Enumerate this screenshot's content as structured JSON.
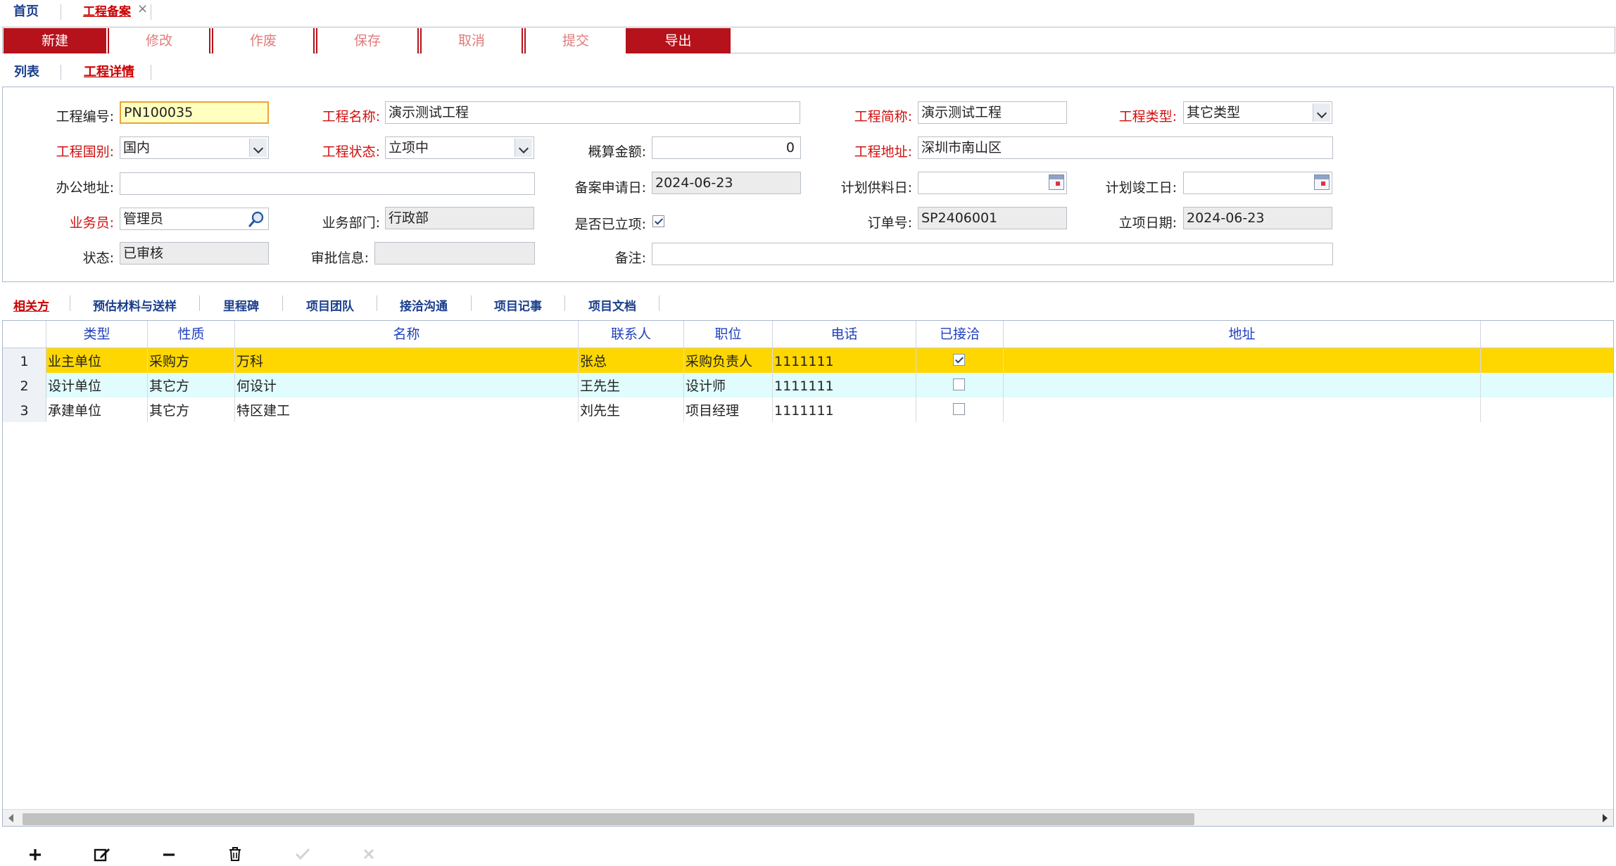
{
  "top_tabs": [
    {
      "label": "首页",
      "active": false
    },
    {
      "label": "工程备案",
      "active": true
    }
  ],
  "tab_close": "×",
  "toolbar": {
    "buttons": [
      {
        "label": "新建",
        "enabled": true
      },
      {
        "label": "修改",
        "enabled": false
      },
      {
        "label": "作废",
        "enabled": false
      },
      {
        "label": "保存",
        "enabled": false
      },
      {
        "label": "取消",
        "enabled": false
      },
      {
        "label": "提交",
        "enabled": false
      },
      {
        "label": "导出",
        "enabled": true
      }
    ]
  },
  "view_tabs": [
    {
      "label": "列表",
      "active": false
    },
    {
      "label": "工程详情",
      "active": true
    }
  ],
  "form": {
    "project_no": {
      "label": "工程编号:",
      "value": "PN100035"
    },
    "project_name": {
      "label": "工程名称:",
      "value": "演示测试工程"
    },
    "short_name": {
      "label": "工程简称:",
      "value": "演示测试工程"
    },
    "project_type": {
      "label": "工程类型:",
      "value": "其它类型"
    },
    "country": {
      "label": "工程国别:",
      "value": "国内"
    },
    "project_status": {
      "label": "工程状态:",
      "value": "立项中"
    },
    "estimate": {
      "label": "概算金额:",
      "value": "0"
    },
    "project_address": {
      "label": "工程地址:",
      "value": "深圳市南山区"
    },
    "office_address": {
      "label": "办公地址:",
      "value": ""
    },
    "apply_date": {
      "label": "备案申请日:",
      "value": "2024-06-23"
    },
    "plan_supply_date": {
      "label": "计划供料日:",
      "value": ""
    },
    "plan_finish_date": {
      "label": "计划竣工日:",
      "value": ""
    },
    "salesman": {
      "label": "业务员:",
      "value": "管理员"
    },
    "department": {
      "label": "业务部门:",
      "value": "行政部"
    },
    "approved": {
      "label": "是否已立项:",
      "checked": true
    },
    "order_no": {
      "label": "订单号:",
      "value": "SP2406001"
    },
    "setup_date": {
      "label": "立项日期:",
      "value": "2024-06-23"
    },
    "status": {
      "label": "状态:",
      "value": "已审核"
    },
    "approval_info": {
      "label": "审批信息:",
      "value": ""
    },
    "remark": {
      "label": "备注:",
      "value": ""
    }
  },
  "detail_tabs": [
    {
      "label": "相关方",
      "active": true
    },
    {
      "label": "预估材料与送样",
      "active": false
    },
    {
      "label": "里程碑",
      "active": false
    },
    {
      "label": "项目团队",
      "active": false
    },
    {
      "label": "接洽沟通",
      "active": false
    },
    {
      "label": "项目记事",
      "active": false
    },
    {
      "label": "项目文档",
      "active": false
    }
  ],
  "grid": {
    "columns": [
      "类型",
      "性质",
      "名称",
      "联系人",
      "职位",
      "电话",
      "已接洽",
      "地址"
    ],
    "rows": [
      {
        "no": "1",
        "type": "业主单位",
        "nature": "采购方",
        "name": "万科",
        "contact": "张总",
        "position": "采购负责人",
        "phone": "1111111",
        "contacted": true,
        "address": ""
      },
      {
        "no": "2",
        "type": "设计单位",
        "nature": "其它方",
        "name": "何设计",
        "contact": "王先生",
        "position": "设计师",
        "phone": "1111111",
        "contacted": false,
        "address": ""
      },
      {
        "no": "3",
        "type": "承建单位",
        "nature": "其它方",
        "name": "特区建工",
        "contact": "刘先生",
        "position": "项目经理",
        "phone": "1111111",
        "contacted": false,
        "address": ""
      }
    ],
    "row_colors": {
      "selected": "#ffd700",
      "hover": "#e0fcfc",
      "normal": "#ffffff"
    }
  },
  "grid_actions": [
    {
      "icon": "plus-icon",
      "enabled": true
    },
    {
      "icon": "edit-icon",
      "enabled": true
    },
    {
      "icon": "minus-icon",
      "enabled": true
    },
    {
      "icon": "trash-icon",
      "enabled": true
    },
    {
      "icon": "check-icon",
      "enabled": false
    },
    {
      "icon": "close-icon",
      "enabled": false
    }
  ],
  "colors": {
    "accent": "#b5121b",
    "required": "#d01010",
    "link": "#1a3e8c",
    "header": "#1f3fbf"
  }
}
